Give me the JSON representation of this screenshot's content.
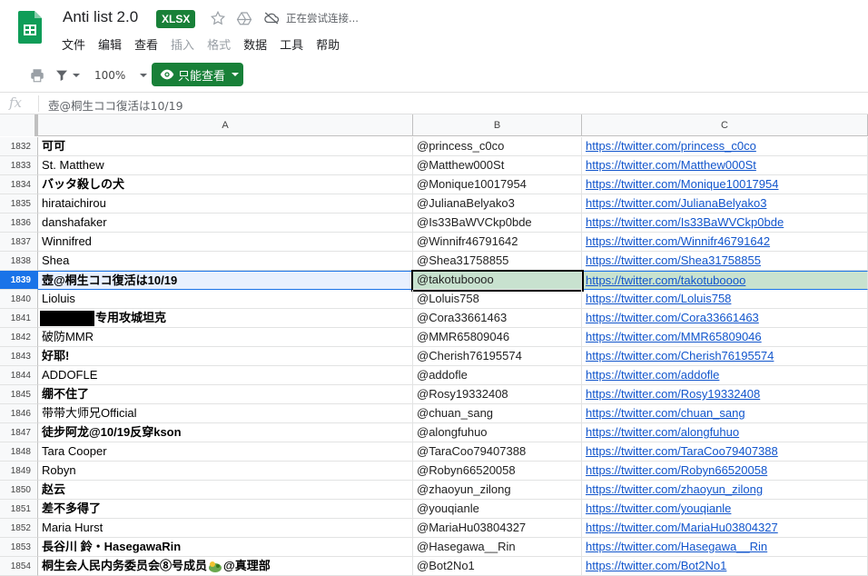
{
  "app": {
    "title": "Anti list 2.0",
    "format_badge": "XLSX",
    "status": "正在尝试连接..."
  },
  "menu": [
    "文件",
    "编辑",
    "查看",
    "插入",
    "格式",
    "数据",
    "工具",
    "帮助"
  ],
  "menu_disabled": [
    false,
    false,
    false,
    true,
    true,
    false,
    false,
    false
  ],
  "toolbar": {
    "zoom": "100%",
    "view_only_label": "只能查看"
  },
  "formula_bar": {
    "fx_label": "fx",
    "content": "壺@桐生ココ復活は10/19"
  },
  "columns": [
    "A",
    "B",
    "C"
  ],
  "rows": [
    {
      "num": "1832",
      "a": "可可",
      "b": "@princess_c0co",
      "c": "https://twitter.com/princess_c0co"
    },
    {
      "num": "1833",
      "a": "St. Matthew",
      "b": "@Matthew000St",
      "c": "https://twitter.com/Matthew000St"
    },
    {
      "num": "1834",
      "a": "バッタ殺しの犬",
      "b": "@Monique10017954",
      "c": "https://twitter.com/Monique10017954"
    },
    {
      "num": "1835",
      "a": "hirataichirou",
      "b": "@JulianaBelyako3",
      "c": "https://twitter.com/JulianaBelyako3"
    },
    {
      "num": "1836",
      "a": "danshafaker",
      "b": "@Is33BaWVCkp0bde",
      "c": "https://twitter.com/Is33BaWVCkp0bde"
    },
    {
      "num": "1837",
      "a": "Winnifred",
      "b": "@Winnifr46791642",
      "c": "https://twitter.com/Winnifr46791642"
    },
    {
      "num": "1838",
      "a": "Shea",
      "b": "@Shea31758855",
      "c": "https://twitter.com/Shea31758855"
    },
    {
      "num": "1839",
      "a": "壺@桐生ココ復活は10/19",
      "b": "@takotuboooo",
      "c": "https://twitter.com/takotuboooo"
    },
    {
      "num": "1840",
      "a": "Lioluis",
      "b": "@Loluis758",
      "c": "https://twitter.com/Loluis758"
    },
    {
      "num": "1841",
      "a": "专用攻城坦克",
      "b": "@Cora33661463",
      "c": "https://twitter.com/Cora33661463"
    },
    {
      "num": "1842",
      "a": "破防MMR",
      "b": "@MMR65809046",
      "c": "https://twitter.com/MMR65809046"
    },
    {
      "num": "1843",
      "a": "好耶!",
      "b": "@Cherish76195574",
      "c": "https://twitter.com/Cherish76195574"
    },
    {
      "num": "1844",
      "a": "ADDOFLE",
      "b": "@addofle",
      "c": "https://twitter.com/addofle"
    },
    {
      "num": "1845",
      "a": "绷不住了",
      "b": "@Rosy19332408",
      "c": "https://twitter.com/Rosy19332408"
    },
    {
      "num": "1846",
      "a": "带带大师兄Official",
      "b": "@chuan_sang",
      "c": "https://twitter.com/chuan_sang"
    },
    {
      "num": "1847",
      "a": "徒步阿龙@10/19反穿kson",
      "b": "@alongfuhuo",
      "c": "https://twitter.com/alongfuhuo"
    },
    {
      "num": "1848",
      "a": "Tara Cooper",
      "b": "@TaraCoo79407388",
      "c": "https://twitter.com/TaraCoo79407388"
    },
    {
      "num": "1849",
      "a": "Robyn",
      "b": "@Robyn66520058",
      "c": "https://twitter.com/Robyn66520058"
    },
    {
      "num": "1850",
      "a": "赵云",
      "b": "@zhaoyun_zilong",
      "c": "https://twitter.com/zhaoyun_zilong"
    },
    {
      "num": "1851",
      "a": "差不多得了",
      "b": "@youqianle",
      "c": "https://twitter.com/youqianle"
    },
    {
      "num": "1852",
      "a": "Maria Hurst",
      "b": "@MariaHu03804327",
      "c": "https://twitter.com/MariaHu03804327"
    },
    {
      "num": "1853",
      "a": "長谷川 鈴・HasegawaRin",
      "b": "@Hasegawa__Rin",
      "c": "https://twitter.com/Hasegawa__Rin"
    },
    {
      "num": "1854",
      "a": "桐生会人民内务委员会⑧号成员 @真理部",
      "b": "@Bot2No1",
      "c": "https://twitter.com/Bot2No1"
    }
  ],
  "row_flags": {
    "bold_a": [
      true,
      false,
      true,
      false,
      false,
      false,
      false,
      true,
      false,
      true,
      false,
      true,
      false,
      true,
      false,
      true,
      false,
      false,
      true,
      true,
      false,
      true,
      true
    ],
    "selected_index": 7,
    "redacted_index": 9,
    "icon_index": 22
  },
  "colors": {
    "accent_green": "#188038",
    "selection_blue": "#1a73e8",
    "link_blue": "#1155cc"
  },
  "icons": [
    "sheets-logo-icon",
    "star-icon",
    "drive-move-icon",
    "cloud-offline-icon",
    "print-icon",
    "filter-icon",
    "eye-icon",
    "chevron-down-icon"
  ]
}
